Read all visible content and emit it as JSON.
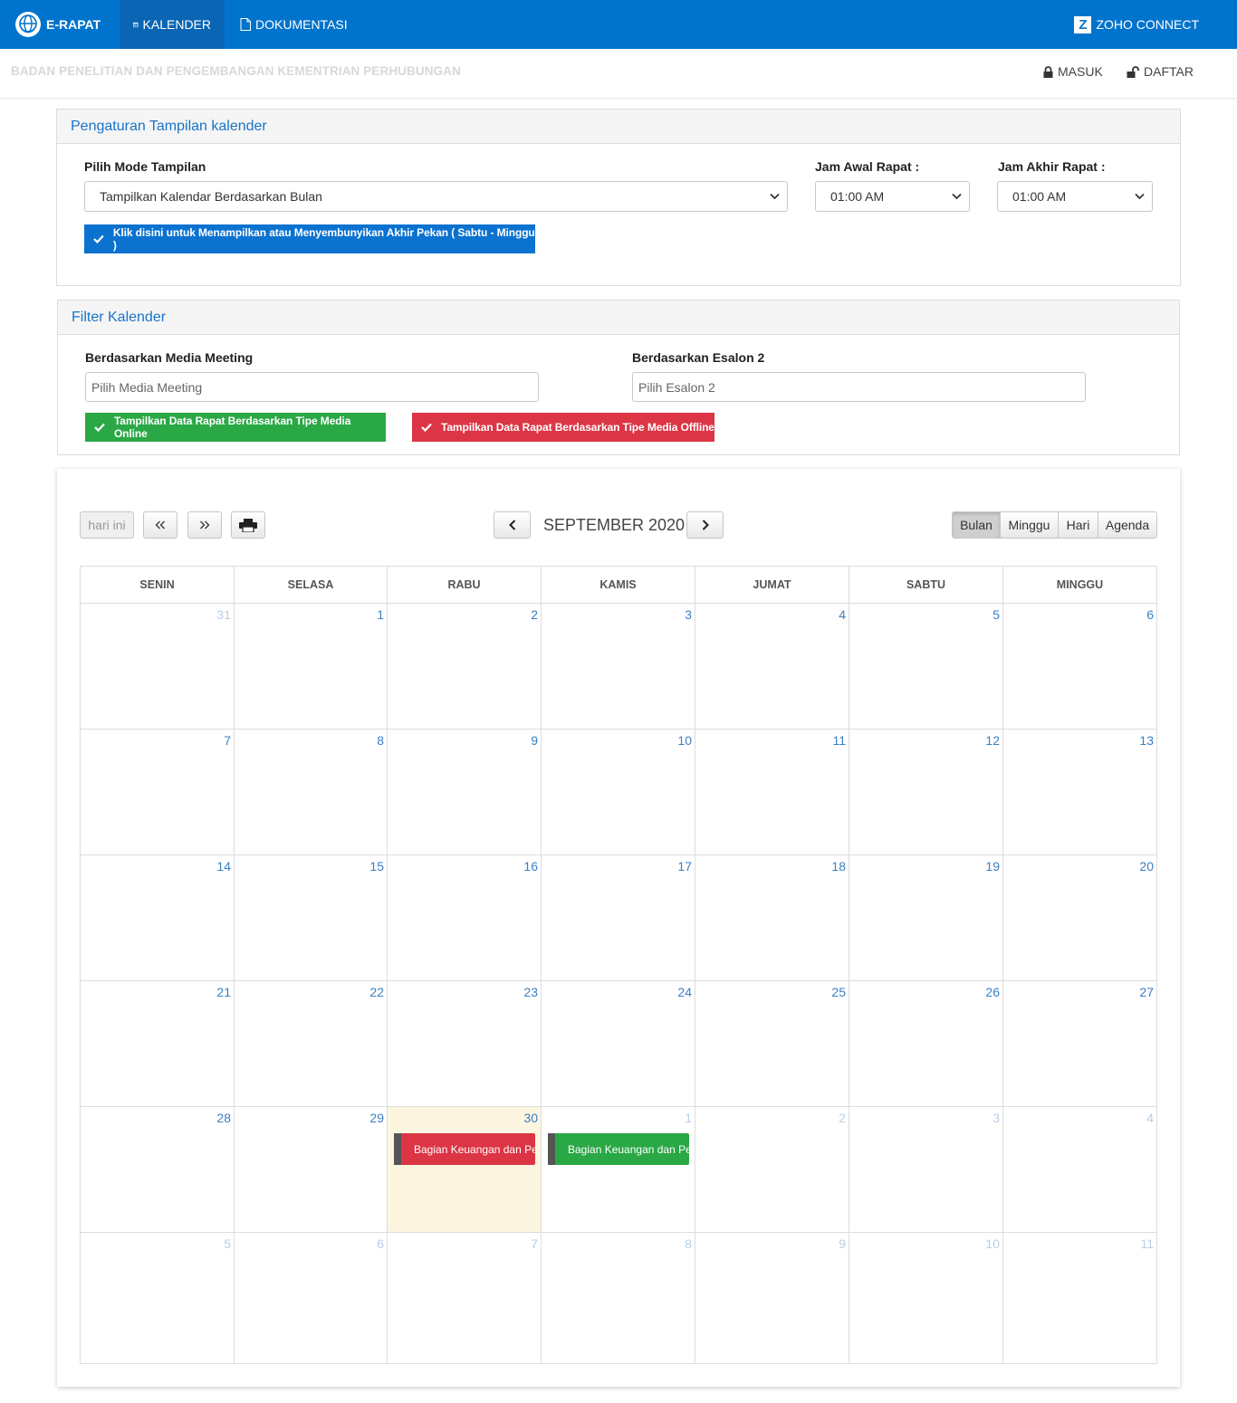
{
  "navbar": {
    "brand": "E-RAPAT",
    "items": [
      {
        "label": "KALENDER",
        "active": true
      },
      {
        "label": "DOKUMENTASI",
        "active": false
      }
    ],
    "zoho": "ZOHO CONNECT"
  },
  "subheader": {
    "org": "BADAN PENELITIAN DAN PENGEMBANGAN KEMENTRIAN PERHUBUNGAN",
    "login": "MASUK",
    "register": "DAFTAR"
  },
  "settings": {
    "title": "Pengaturan Tampilan kalender",
    "mode_label": "Pilih Mode Tampilan",
    "mode_value": "Tampilkan Kalendar Berdasarkan Bulan",
    "start_label": "Jam Awal Rapat :",
    "start_value": "01:00 AM",
    "end_label": "Jam Akhir Rapat :",
    "end_value": "01:00 AM",
    "weekend_button": "Klik disini untuk Menampilkan atau Menyembunyikan Akhir Pekan ( Sabtu - Minggu )"
  },
  "filter": {
    "title": "Filter Kalender",
    "media_label": "Berdasarkan Media Meeting",
    "media_placeholder": "Pilih Media Meeting",
    "esalon_label": "Berdasarkan Esalon 2",
    "esalon_placeholder": "Pilih Esalon 2",
    "online_button": "Tampilkan Data Rapat Berdasarkan Tipe Media Online",
    "offline_button": "Tampilkan Data Rapat Berdasarkan Tipe Media Offline"
  },
  "calendar": {
    "today_button": "hari ini",
    "title": "SEPTEMBER 2020",
    "views": [
      {
        "label": "Bulan",
        "active": true
      },
      {
        "label": "Minggu",
        "active": false
      },
      {
        "label": "Hari",
        "active": false
      },
      {
        "label": "Agenda",
        "active": false
      }
    ],
    "days_of_week": [
      "SENIN",
      "SELASA",
      "RABU",
      "KAMIS",
      "JUMAT",
      "SABTU",
      "MINGGU"
    ],
    "weeks": [
      [
        {
          "d": "31",
          "o": true
        },
        {
          "d": "1"
        },
        {
          "d": "2"
        },
        {
          "d": "3"
        },
        {
          "d": "4"
        },
        {
          "d": "5"
        },
        {
          "d": "6"
        }
      ],
      [
        {
          "d": "7"
        },
        {
          "d": "8"
        },
        {
          "d": "9"
        },
        {
          "d": "10"
        },
        {
          "d": "11"
        },
        {
          "d": "12"
        },
        {
          "d": "13"
        }
      ],
      [
        {
          "d": "14"
        },
        {
          "d": "15"
        },
        {
          "d": "16"
        },
        {
          "d": "17"
        },
        {
          "d": "18"
        },
        {
          "d": "19"
        },
        {
          "d": "20"
        }
      ],
      [
        {
          "d": "21"
        },
        {
          "d": "22"
        },
        {
          "d": "23"
        },
        {
          "d": "24"
        },
        {
          "d": "25"
        },
        {
          "d": "26"
        },
        {
          "d": "27"
        }
      ],
      [
        {
          "d": "28"
        },
        {
          "d": "29"
        },
        {
          "d": "30",
          "today": true
        },
        {
          "d": "1",
          "o": true
        },
        {
          "d": "2",
          "o": true
        },
        {
          "d": "3",
          "o": true
        },
        {
          "d": "4",
          "o": true
        }
      ],
      [
        {
          "d": "5",
          "o": true
        },
        {
          "d": "6",
          "o": true
        },
        {
          "d": "7",
          "o": true
        },
        {
          "d": "8",
          "o": true
        },
        {
          "d": "9",
          "o": true
        },
        {
          "d": "10",
          "o": true
        },
        {
          "d": "11",
          "o": true
        }
      ]
    ],
    "events": [
      {
        "label": "Bagian Keuangan dan Pe",
        "week": 4,
        "day": 2,
        "color": "#dc3545",
        "type": "offline"
      },
      {
        "label": "Bagian Keuangan dan Pe",
        "week": 4,
        "day": 3,
        "color": "#2aa845",
        "type": "online"
      }
    ]
  }
}
